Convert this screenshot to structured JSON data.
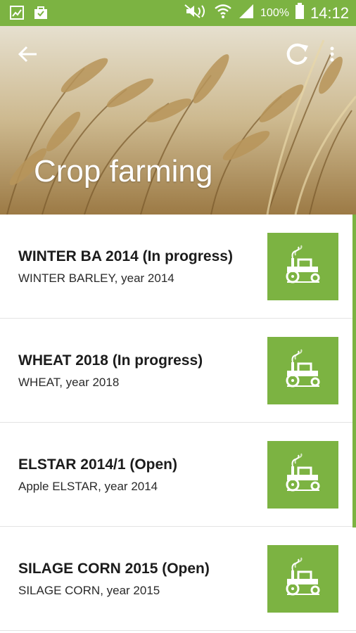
{
  "status_bar": {
    "battery_percent": "100%",
    "time": "14:12"
  },
  "header": {
    "title": "Crop farming"
  },
  "icons": {
    "back": "arrow-back-icon",
    "refresh": "refresh-icon",
    "more": "more-vert-icon",
    "item": "tractor-icon"
  },
  "colors": {
    "accent": "#7cb342",
    "title_text": "#1c1c1c"
  },
  "crops": [
    {
      "title": "WINTER BA 2014 (In progress)",
      "subtitle": "WINTER BARLEY, year 2014"
    },
    {
      "title": "WHEAT 2018 (In progress)",
      "subtitle": "WHEAT, year 2018"
    },
    {
      "title": "ELSTAR 2014/1 (Open)",
      "subtitle": "Apple ELSTAR, year 2014"
    },
    {
      "title": "SILAGE CORN 2015 (Open)",
      "subtitle": "SILAGE CORN, year 2015"
    }
  ]
}
